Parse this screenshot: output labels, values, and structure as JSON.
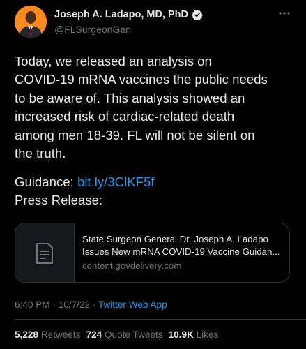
{
  "author": {
    "name": "Joseph A. Ladapo, MD, PhD",
    "handle": "@FLSurgeonGen",
    "verified": true,
    "avatar_bg_color": "#ff8a1c"
  },
  "tweet": {
    "lines": [
      "Today, we released an analysis on",
      "COVID-19 mRNA vaccines the public needs",
      "to be aware of. This analysis showed an",
      "increased risk of cardiac-related death",
      "among men 18-39. FL will not be silent on",
      "the truth."
    ],
    "guidance_label": "Guidance:",
    "guidance_link": "bit.ly/3ClKF5f",
    "press_label": "Press Release:"
  },
  "card": {
    "title_line1": "State Surgeon General Dr. Joseph A. Ladapo",
    "title_line2": "Issues New mRNA COVID-19 Vaccine Guidan...",
    "domain": "content.govdelivery.com",
    "icon": "document-icon"
  },
  "meta": {
    "time": "6:40 PM",
    "separator1": " · ",
    "date": "10/7/22",
    "separator2": " · ",
    "source": "Twitter Web App"
  },
  "stats": {
    "retweets_count": "5,228",
    "retweets_label": "Retweets",
    "quotes_count": "724",
    "quotes_label": "Quote Tweets",
    "likes_count": "10.9K",
    "likes_label": "Likes"
  },
  "colors": {
    "background": "#000000",
    "text_primary": "#e7e9ea",
    "text_secondary": "#71767b",
    "link": "#1d9bf0",
    "border": "#2f3336"
  }
}
